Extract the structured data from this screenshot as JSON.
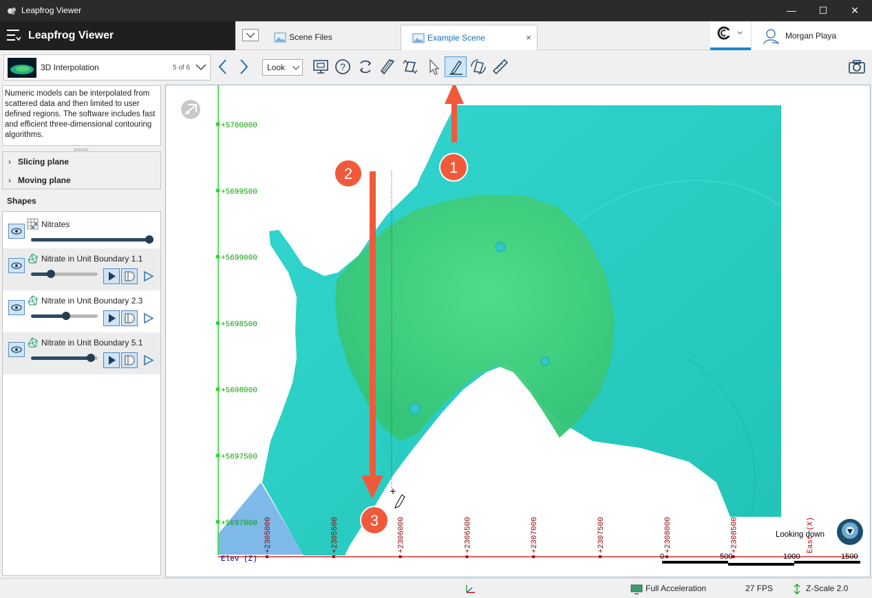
{
  "window": {
    "title": "Leapfrog Viewer"
  },
  "header": {
    "app_name": "Leapfrog Viewer",
    "user_name": "Morgan Playa"
  },
  "tabs": [
    {
      "label": "Scene Files",
      "active": false
    },
    {
      "label": "Example Scene",
      "active": true,
      "close_glyph": "×"
    }
  ],
  "toolbar": {
    "scene_name": "3D Interpolation",
    "scene_position": "5 of 6",
    "look_mode": "Look",
    "active_tool": "draw-polyline-icon"
  },
  "left_panel": {
    "description": "Numeric models can be interpolated from scattered data and then limited to user defined regions. The software includes fast and efficient three-dimensional contouring algorithms.",
    "planes": [
      "Slicing plane",
      "Moving plane"
    ],
    "shapes_header": "Shapes",
    "shapes": [
      {
        "name": "Nitrates",
        "icon": "grid-points-icon",
        "opacity": 1.0,
        "has_controls": false
      },
      {
        "name": "Nitrate in Unit Boundary 1.1",
        "icon": "mesh-icon",
        "opacity": 0.3,
        "has_controls": true
      },
      {
        "name": "Nitrate in Unit Boundary 2.3",
        "icon": "mesh-icon",
        "opacity": 0.55,
        "has_controls": true
      },
      {
        "name": "Nitrate in Unit Boundary 5.1",
        "icon": "mesh-icon",
        "opacity": 0.95,
        "has_controls": true
      }
    ]
  },
  "viewport": {
    "north_ticks": [
      "+5700000",
      "+5699500",
      "+5699000",
      "+5698500",
      "+5698000",
      "+5697500",
      "+5697000"
    ],
    "east_ticks": [
      "+2305000",
      "+2305500",
      "+2306000",
      "+2306500",
      "+2307000",
      "+2307500",
      "+2308000",
      "+2308500"
    ],
    "elev_label": "Elev (Z)",
    "east_label": "East (X)",
    "view_direction": "Looking down",
    "scale_labels": [
      "0",
      "500",
      "1000",
      "1500"
    ],
    "annotations": [
      "1",
      "2",
      "3"
    ],
    "colors": {
      "annotation": "#f05a3a",
      "outer_surface": "#2ecfc4",
      "inner_surface": "#3fd07a",
      "north_axis": "#00a000",
      "east_axis": "#c00000"
    }
  },
  "statusbar": {
    "acceleration": "Full Acceleration",
    "fps": "27 FPS",
    "zscale": "Z-Scale 2.0"
  }
}
